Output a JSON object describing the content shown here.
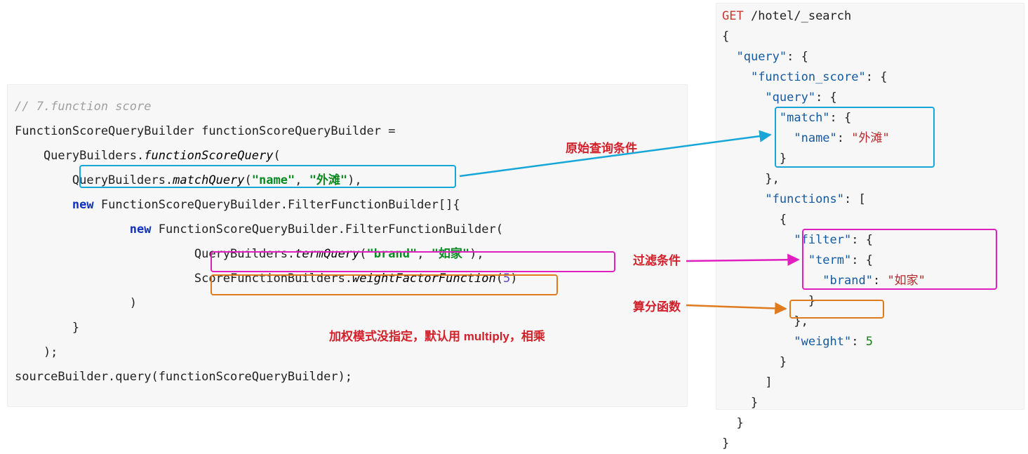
{
  "left": {
    "comment": "// 7.function score",
    "l1_a": "FunctionScoreQueryBuilder functionScoreQueryBuilder =",
    "l2_a": "    QueryBuilders.",
    "l2_b": "functionScoreQuery",
    "l2_c": "(",
    "l3_a": "        QueryBuilders.",
    "l3_b": "matchQuery",
    "l3_c": "(",
    "l3_d": "\"name\"",
    "l3_e": ", ",
    "l3_f": "\"外滩\"",
    "l3_g": "),",
    "l4_a": "        ",
    "l4_b": "new",
    "l4_c": " FunctionScoreQueryBuilder.FilterFunctionBuilder[]{",
    "l5_a": "                ",
    "l5_b": "new",
    "l5_c": " FunctionScoreQueryBuilder.FilterFunctionBuilder(",
    "l6_a": "                         QueryBuilders.",
    "l6_b": "termQuery",
    "l6_c": "(",
    "l6_d": "\"brand\"",
    "l6_e": ", ",
    "l6_f": "\"如家\"",
    "l6_g": "),",
    "l7_a": "                         ScoreFunctionBuilders.",
    "l7_b": "weightFactorFunction",
    "l7_c": "(",
    "l7_d": "5",
    "l7_e": ")",
    "l8": "                )",
    "l9": "        }",
    "l10": "    );",
    "l11": "sourceBuilder.query(functionScoreQueryBuilder);"
  },
  "right": {
    "r1a": "GET",
    "r1b": " /hotel/_search",
    "r2": "{",
    "r3a": "  ",
    "r3b": "\"query\"",
    "r3c": ": {",
    "r4a": "    ",
    "r4b": "\"function_score\"",
    "r4c": ": {",
    "r5a": "      ",
    "r5b": "\"query\"",
    "r5c": ": {",
    "r6a": "        ",
    "r6b": "\"match\"",
    "r6c": ": {",
    "r7a": "          ",
    "r7b": "\"name\"",
    "r7c": ": ",
    "r7d": "\"外滩\"",
    "r8": "        }",
    "r9": "      },",
    "r10a": "      ",
    "r10b": "\"functions\"",
    "r10c": ": [",
    "r11": "        {",
    "r12a": "          ",
    "r12b": "\"filter\"",
    "r12c": ": {",
    "r13a": "            ",
    "r13b": "\"term\"",
    "r13c": ": {",
    "r14a": "              ",
    "r14b": "\"brand\"",
    "r14c": ": ",
    "r14d": "\"如家\"",
    "r15": "            }",
    "r16": "          },",
    "r17a": "          ",
    "r17b": "\"weight\"",
    "r17c": ": ",
    "r17d": "5",
    "r18": "        }",
    "r19": "      ]",
    "r20": "    }",
    "r21": "  }",
    "r22": "}"
  },
  "ann": {
    "a1": "原始查询条件",
    "a2": "过滤条件",
    "a3": "算分函数",
    "a4": "加权模式没指定，默认用 multiply，相乘"
  }
}
